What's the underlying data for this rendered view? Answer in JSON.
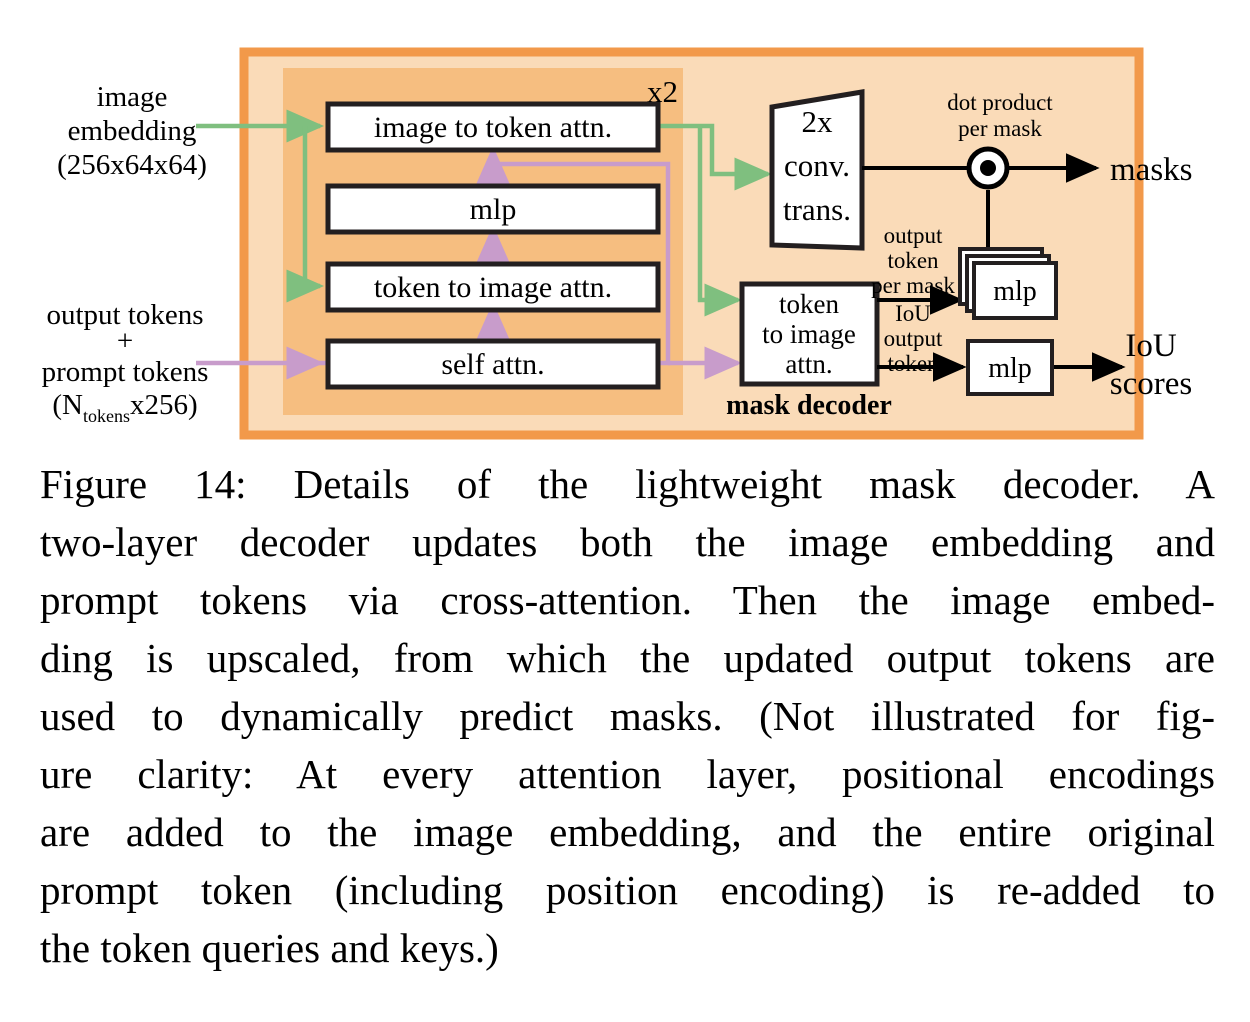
{
  "figure": {
    "label": "Figure 14:",
    "panel_title": "mask decoder",
    "repeat_badge": "x2",
    "colors": {
      "outer_border": "#F2994A",
      "outer_fill": "#FADBB8",
      "inner_fill": "#F6BE80",
      "box_fill": "#FFFFFF",
      "box_border": "#231F20",
      "green_arrow": "#7FBF7F",
      "purple_arrow": "#C89CCB",
      "black_arrow": "#000000"
    },
    "inputs": [
      {
        "id": "image-embedding",
        "lines": [
          "image",
          "embedding",
          "(256x64x64)"
        ]
      },
      {
        "id": "prompt-tokens",
        "lines": [
          "output tokens",
          "+",
          "prompt tokens"
        ],
        "dim_prefix": "(N",
        "dim_subscript": "tokens",
        "dim_suffix": "x256)"
      }
    ],
    "decoder_blocks": [
      {
        "id": "image-to-token-attn",
        "label": "image to token attn."
      },
      {
        "id": "mlp",
        "label": "mlp"
      },
      {
        "id": "token-to-image-attn",
        "label": "token to image attn."
      },
      {
        "id": "self-attn",
        "label": "self attn."
      }
    ],
    "upscale_block": {
      "id": "conv-trans",
      "lines": [
        "2x",
        "conv.",
        "trans."
      ]
    },
    "final_attn_block": {
      "id": "token-to-image-attn-final",
      "lines": [
        "token",
        "to image",
        "attn."
      ]
    },
    "dot_product_label": [
      "dot product",
      "per mask"
    ],
    "output_token_label": [
      "output",
      "token",
      "per mask"
    ],
    "iou_token_label": [
      "IoU",
      "output",
      "token"
    ],
    "mlp_stack_label": "mlp",
    "mlp_single_label": "mlp",
    "outputs": [
      {
        "id": "masks",
        "lines": [
          "masks"
        ]
      },
      {
        "id": "iou-scores",
        "lines": [
          "IoU",
          "scores"
        ]
      }
    ]
  },
  "caption": {
    "lines": [
      "Figure 14:  Details of the lightweight mask decoder.  A",
      "two-layer decoder updates both the image embedding and",
      "prompt tokens via cross-attention.  Then the image embed-",
      "ding is upscaled, from which the updated output tokens are",
      "used to dynamically predict masks. (Not illustrated for fig-",
      "ure clarity:  At every attention layer, positional encodings",
      "are added to the image embedding, and the entire original",
      "prompt token (including position encoding) is re-added to",
      "the token queries and keys.)"
    ],
    "full_text": "Figure 14: Details of the lightweight mask decoder. A two-layer decoder updates both the image embedding and prompt tokens via cross-attention. Then the image embedding is upscaled, from which the updated output tokens are used to dynamically predict masks. (Not illustrated for figure clarity: At every attention layer, positional encodings are added to the image embedding, and the entire original prompt token (including position encoding) is re-added to the token queries and keys.)"
  }
}
